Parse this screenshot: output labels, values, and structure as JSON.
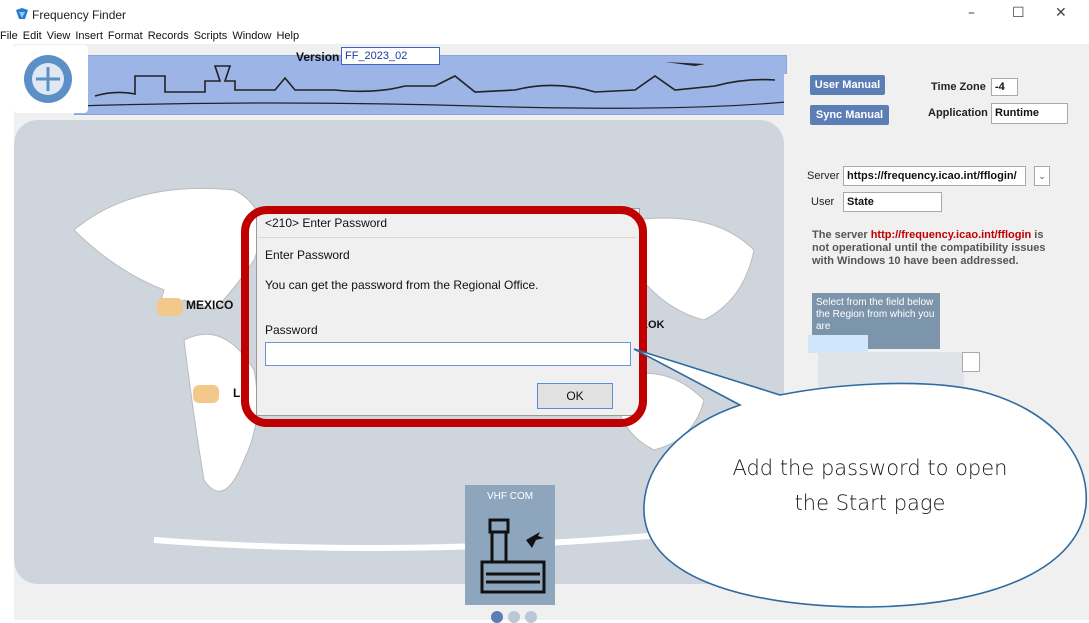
{
  "window": {
    "title": "Frequency Finder",
    "controls": {
      "minimize": "–",
      "maximize": "☐",
      "close": "✕"
    }
  },
  "menu": [
    "File",
    "Edit",
    "View",
    "Insert",
    "Format",
    "Records",
    "Scripts",
    "Window",
    "Help"
  ],
  "header": {
    "version_label": "Version",
    "version_value": "FF_2023_02"
  },
  "right_panel": {
    "user_manual": "User Manual",
    "sync_manual": "Sync Manual",
    "time_zone_label": "Time Zone",
    "time_zone_value": "-4",
    "application_label": "Application",
    "application_value": "Runtime",
    "server_label": "Server",
    "server_value": "https://frequency.icao.int/fflogin/",
    "user_label": "User",
    "user_value": "State",
    "notice_prefix": "The server ",
    "notice_url": "http://frequency.icao.int/fflogin",
    "notice_suffix": " is not operational until the compatibility issues with Windows 10 have been addressed.",
    "region_text": "Select from the field below the Region from which you are"
  },
  "map": {
    "labels": {
      "mexico": "MEXICO",
      "lima": "LIMA",
      "bangkok": "KOK"
    }
  },
  "dialog": {
    "title": "<210> Enter Password",
    "heading": "Enter Password",
    "message": "You can get the password from the Regional Office.",
    "password_label": "Password",
    "password_value": "",
    "ok_label": "OK"
  },
  "callout": {
    "line1": "Add the password to open",
    "line2": "the Start page"
  },
  "tile": {
    "label": "VHF COM"
  },
  "colors": {
    "highlight": "#c00000",
    "button_blue": "#5b7fb5",
    "banner_blue": "#9cb4e6"
  }
}
